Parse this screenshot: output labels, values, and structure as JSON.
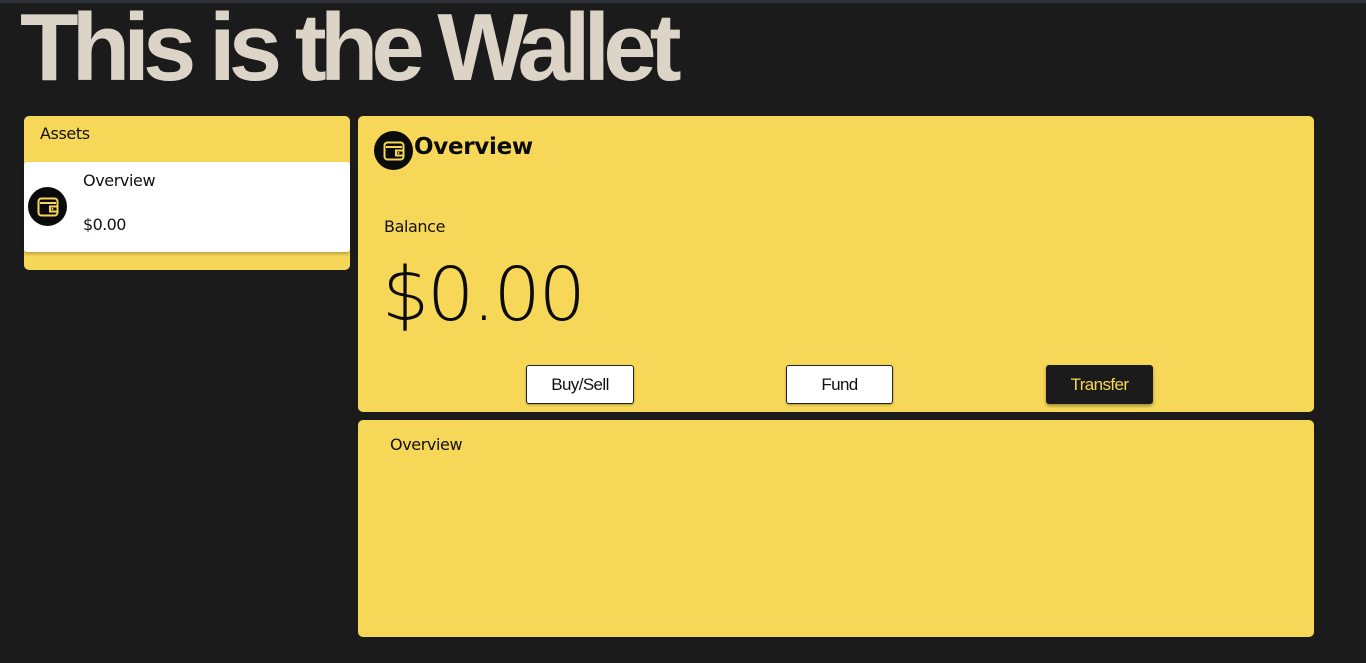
{
  "header": {
    "title": "This is the Wallet"
  },
  "colors": {
    "background": "#1b1b1b",
    "accent": "#f6d757",
    "title": "#ddd4c8"
  },
  "assets": {
    "heading": "Assets",
    "items": [
      {
        "name": "Overview",
        "value": "$0.00",
        "icon": "wallet-icon"
      }
    ]
  },
  "overview": {
    "title": "Overview",
    "icon": "wallet-icon",
    "balance_label": "Balance",
    "balance_amount": "$0.00",
    "buttons": {
      "buy_sell": "Buy/Sell",
      "fund": "Fund",
      "transfer": "Transfer"
    }
  },
  "overview_panel": {
    "heading": "Overview"
  }
}
